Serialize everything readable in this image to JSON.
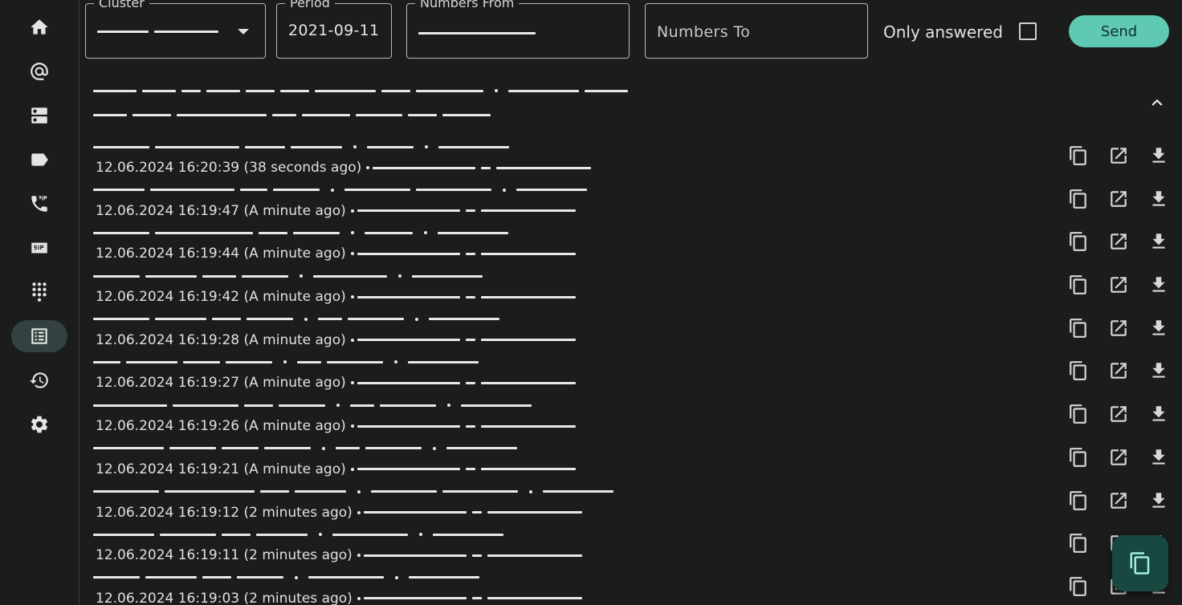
{
  "nav": {
    "items": [
      {
        "name": "home",
        "active": false
      },
      {
        "name": "mentions",
        "active": false
      },
      {
        "name": "servers",
        "active": false
      },
      {
        "name": "labels",
        "active": false
      },
      {
        "name": "sip-phone",
        "active": false
      },
      {
        "name": "sip",
        "active": false
      },
      {
        "name": "dialpad",
        "active": false
      },
      {
        "name": "call-records",
        "active": true
      },
      {
        "name": "history",
        "active": false
      },
      {
        "name": "settings",
        "active": false
      }
    ]
  },
  "filters": {
    "cluster_label": "Cluster",
    "period_label": "Period",
    "period_value": "2021-09-11",
    "numbers_from_label": "Numbers From",
    "numbers_to_placeholder": "Numbers To",
    "only_answered_label": "Only answered",
    "only_answered_checked": false,
    "send_label": "Send"
  },
  "rows": [
    {
      "time": "12.06.2024 16:20:39 (38 seconds ago)"
    },
    {
      "time": "12.06.2024 16:19:47 (A minute ago)"
    },
    {
      "time": "12.06.2024 16:19:44 (A minute ago)"
    },
    {
      "time": "12.06.2024 16:19:42 (A minute ago)"
    },
    {
      "time": "12.06.2024 16:19:28 (A minute ago)"
    },
    {
      "time": "12.06.2024 16:19:27 (A minute ago)"
    },
    {
      "time": "12.06.2024 16:19:26 (A minute ago)"
    },
    {
      "time": "12.06.2024 16:19:21 (A minute ago)"
    },
    {
      "time": "12.06.2024 16:19:12 (2 minutes ago)"
    },
    {
      "time": "12.06.2024 16:19:11 (2 minutes ago)"
    },
    {
      "time": "12.06.2024 16:19:03 (2 minutes ago)"
    }
  ],
  "row_actions": [
    "copy-icon",
    "open-in-new-icon",
    "download-icon"
  ],
  "colors": {
    "background": "#1b1c1c",
    "accent": "#5fc9b4",
    "fab": "#194840",
    "nav_active": "#334240"
  }
}
